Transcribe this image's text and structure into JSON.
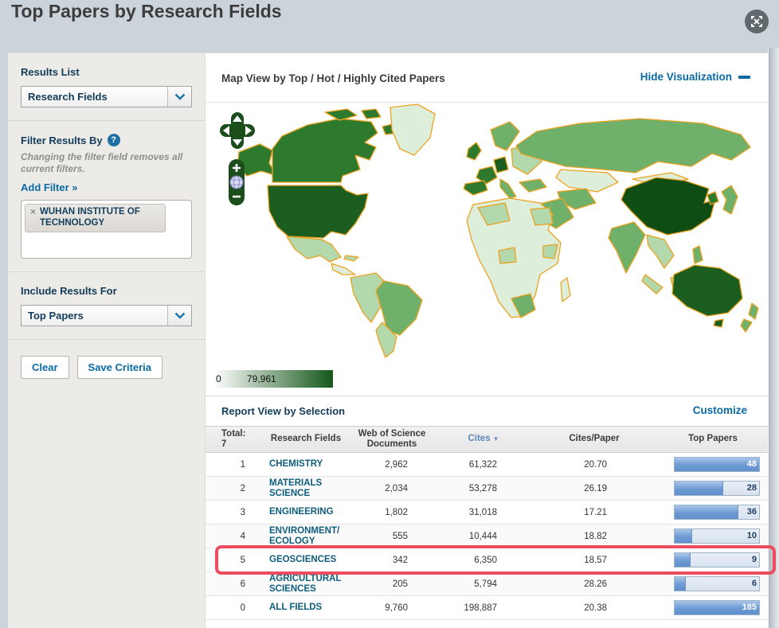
{
  "header": {
    "title": "Top Papers by Research Fields"
  },
  "sidebar": {
    "results_list_label": "Results List",
    "results_list_value": "Research Fields",
    "filter_heading": "Filter Results By",
    "help_glyph": "?",
    "filter_note": "Changing the filter field removes all current filters.",
    "add_filter_label": "Add Filter »",
    "filter_chip": {
      "remove_glyph": "×",
      "label": "WUHAN INSTITUTE OF TECHNOLOGY"
    },
    "include_label": "Include Results For",
    "include_value": "Top Papers",
    "clear_button": "Clear",
    "save_button": "Save Criteria"
  },
  "map": {
    "title": "Map View by Top / Hot / Highly Cited Papers",
    "hide_link": "Hide Visualization",
    "legend_min": "0",
    "legend_max": "79,961",
    "colors": {
      "border": "#EDA21F",
      "scale_low": "#FFFFFF",
      "scale_high": "#15571A"
    }
  },
  "report": {
    "title": "Report View by Selection",
    "customize_link": "Customize",
    "total_label": "Total:",
    "total_value": "7",
    "columns": [
      "Research Fields",
      "Web of Science Documents",
      "Cites",
      "Cites/Paper",
      "Top Papers"
    ],
    "sort": {
      "column": "Cites",
      "direction": "desc",
      "glyph": "▼"
    },
    "rows": [
      {
        "rank": "1",
        "field": "CHEMISTRY",
        "docs": "2,962",
        "cites": "61,322",
        "cites_per_paper": "20.70",
        "top_papers": "48",
        "bar_pct": 100,
        "bar_text_light": true,
        "highlighted": false
      },
      {
        "rank": "2",
        "field": "MATERIALS SCIENCE",
        "docs": "2,034",
        "cites": "53,278",
        "cites_per_paper": "26.19",
        "top_papers": "28",
        "bar_pct": 58,
        "bar_text_light": false,
        "highlighted": false
      },
      {
        "rank": "3",
        "field": "ENGINEERING",
        "docs": "1,802",
        "cites": "31,018",
        "cites_per_paper": "17.21",
        "top_papers": "36",
        "bar_pct": 75,
        "bar_text_light": false,
        "highlighted": false
      },
      {
        "rank": "4",
        "field": "ENVIRONMENT/ECOLOGY",
        "docs": "555",
        "cites": "10,444",
        "cites_per_paper": "18.82",
        "top_papers": "10",
        "bar_pct": 21,
        "bar_text_light": false,
        "highlighted": false
      },
      {
        "rank": "5",
        "field": "GEOSCIENCES",
        "docs": "342",
        "cites": "6,350",
        "cites_per_paper": "18.57",
        "top_papers": "9",
        "bar_pct": 19,
        "bar_text_light": false,
        "highlighted": true
      },
      {
        "rank": "6",
        "field": "AGRICULTURAL SCIENCES",
        "docs": "205",
        "cites": "5,794",
        "cites_per_paper": "28.26",
        "top_papers": "6",
        "bar_pct": 13,
        "bar_text_light": false,
        "highlighted": false
      },
      {
        "rank": "0",
        "field": "ALL FIELDS",
        "docs": "9,760",
        "cites": "198,887",
        "cites_per_paper": "20.38",
        "top_papers": "185",
        "bar_pct": 100,
        "bar_text_light": true,
        "highlighted": false
      }
    ]
  }
}
